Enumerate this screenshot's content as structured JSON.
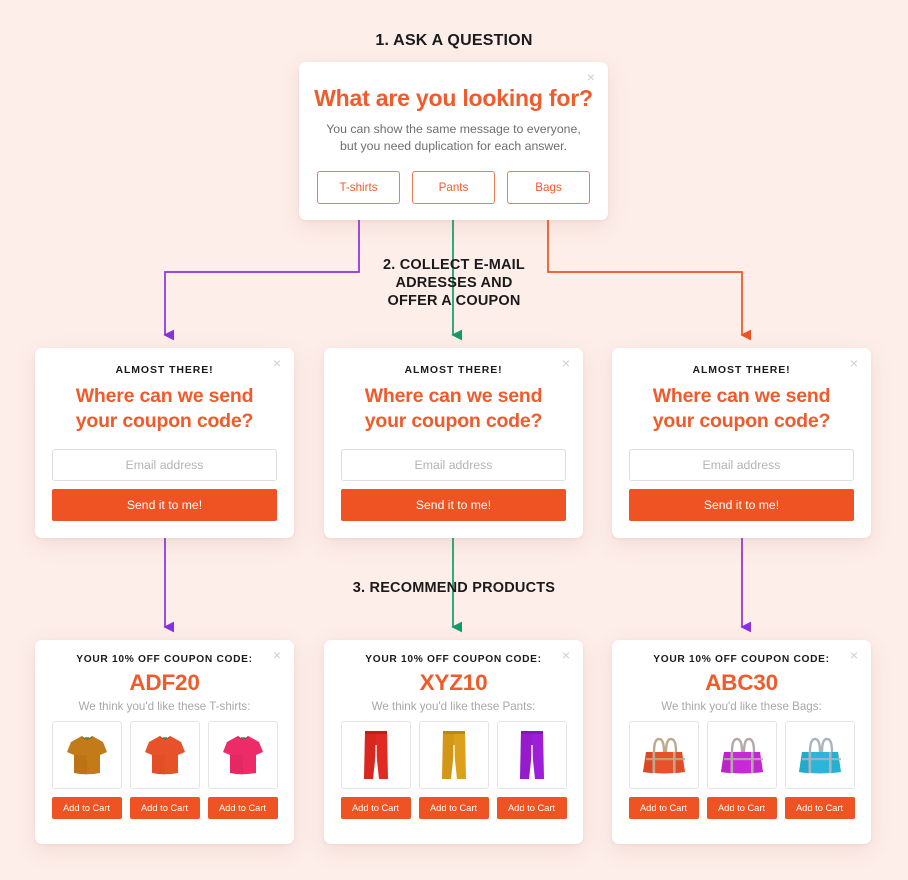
{
  "page": {
    "background_color": "#fdeeea",
    "accent_orange": "#f15a2b",
    "button_orange": "#ef5223"
  },
  "steps": {
    "step1": "1. ASK A QUESTION",
    "step2_line1": "2. COLLECT E-MAIL",
    "step2_line2": "ADRESSES AND",
    "step2_line3": "OFFER A COUPON",
    "step3": "3. RECOMMEND PRODUCTS"
  },
  "close_icon": "×",
  "question_card": {
    "title": "What are you looking for?",
    "subtitle": "You can show the same message to everyone, but you need duplication for each answer.",
    "choices": [
      {
        "label": "T-shirts",
        "dot_color": "#8b30e0"
      },
      {
        "label": "Pants",
        "dot_color": "#0f9b6c"
      },
      {
        "label": "Bags",
        "dot_color": "#ef5223"
      }
    ]
  },
  "email_cards": [
    {
      "eyebrow": "ALMOST THERE!",
      "head_line1": "Where can we send",
      "head_line2": "your coupon code?",
      "input_placeholder": "Email address",
      "input_value": "",
      "button_label": "Send it to me!"
    },
    {
      "eyebrow": "ALMOST THERE!",
      "head_line1": "Where can we send",
      "head_line2": "your coupon code?",
      "input_placeholder": "Email address",
      "input_value": "",
      "button_label": "Send it to me!"
    },
    {
      "eyebrow": "ALMOST THERE!",
      "head_line1": "Where can we send",
      "head_line2": "your coupon code?",
      "input_placeholder": "Email address",
      "input_value": "",
      "button_label": "Send it to me!"
    }
  ],
  "product_cards": [
    {
      "coupon_label": "YOUR 10% OFF COUPON CODE:",
      "coupon_code": "ADF20",
      "reco_line": "We think you'd like these T-shirts:",
      "product_type": "tshirt",
      "cart_label": "Add to Cart",
      "items": [
        {
          "name": "tshirt-goldenrod",
          "color": "#c27b18",
          "shade": "#a96610"
        },
        {
          "name": "tshirt-orange",
          "color": "#e8522a",
          "shade": "#cf4420"
        },
        {
          "name": "tshirt-pink",
          "color": "#ec2b68",
          "shade": "#d21f57"
        }
      ]
    },
    {
      "coupon_label": "YOUR 10% OFF COUPON CODE:",
      "coupon_code": "XYZ10",
      "reco_line": "We think you'd like these Pants:",
      "product_type": "pants",
      "cart_label": "Add to Cart",
      "items": [
        {
          "name": "pants-red",
          "color": "#e12b22",
          "shade": "#bf1f18"
        },
        {
          "name": "pants-gold",
          "color": "#dda01a",
          "shade": "#bd8512"
        },
        {
          "name": "pants-purple",
          "color": "#9d1ed6",
          "shade": "#8417b6"
        }
      ]
    },
    {
      "coupon_label": "YOUR 10% OFF COUPON CODE:",
      "coupon_code": "ABC30",
      "reco_line": "We think you'd like these Bags:",
      "product_type": "bag",
      "cart_label": "Add to Cart",
      "items": [
        {
          "name": "bag-orange",
          "color": "#e8512a",
          "shade": "#c8401f",
          "handle": "#bda98d"
        },
        {
          "name": "bag-magenta",
          "color": "#c928d8",
          "shade": "#ab20b8",
          "handle": "#b3a9a9"
        },
        {
          "name": "bag-cyan",
          "color": "#29b6d8",
          "shade": "#1f9bb8",
          "handle": "#a9b4bd"
        }
      ]
    }
  ],
  "connectors": {
    "purple": "#8b30e0",
    "green": "#0f9b6c",
    "orange": "#ef5223"
  }
}
